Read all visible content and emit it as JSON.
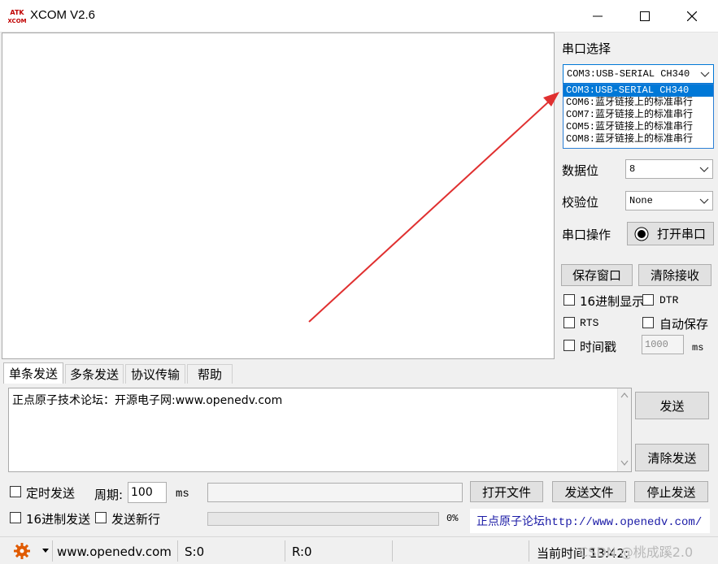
{
  "window": {
    "title": "XCOM V2.6",
    "logo_text": "ATK XCOM"
  },
  "serial": {
    "port_label": "串口选择",
    "port_value": "COM3:USB-SERIAL CH340",
    "port_options": [
      "COM3:USB-SERIAL CH340",
      "COM6:蓝牙链接上的标准串行",
      "COM7:蓝牙链接上的标准串行",
      "COM5:蓝牙链接上的标准串行",
      "COM8:蓝牙链接上的标准串行"
    ],
    "databits_label": "数据位",
    "databits_value": "8",
    "parity_label": "校验位",
    "parity_value": "None",
    "operation_label": "串口操作",
    "open_port_label": "打开串口"
  },
  "panel": {
    "save_window_label": "保存窗口",
    "clear_recv_label": "清除接收",
    "hex_display_label": "16进制显示",
    "dtr_label": "DTR",
    "rts_label": "RTS",
    "auto_save_label": "自动保存",
    "timestamp_label": "时间戳",
    "timestamp_value": "1000",
    "timestamp_unit": "ms"
  },
  "tabs": [
    "单条发送",
    "多条发送",
    "协议传输",
    "帮助"
  ],
  "send": {
    "text": "正点原子技术论坛：开源电子网:www.openedv.com",
    "send_label": "发送",
    "clear_send_label": "清除发送",
    "timed_send_label": "定时发送",
    "period_label": "周期:",
    "period_value": "100",
    "period_unit": "ms",
    "open_file_label": "打开文件",
    "send_file_label": "发送文件",
    "stop_send_label": "停止发送",
    "hex_send_label": "16进制发送",
    "send_newline_label": "发送新行",
    "progress_text": "0%",
    "progress": 0,
    "forum_link": "正点原子论坛http://www.openedv.com/"
  },
  "status": {
    "website": "www.openedv.com",
    "sent": "S:0",
    "received": "R:0",
    "time": "当前时间 13:42:"
  },
  "watermark": "CSDN @桃成蹊2.0",
  "colors": {
    "selection": "#0078d7",
    "arrow": "#e03030",
    "link": "#1a1aa6",
    "gear": "#e05a00"
  }
}
